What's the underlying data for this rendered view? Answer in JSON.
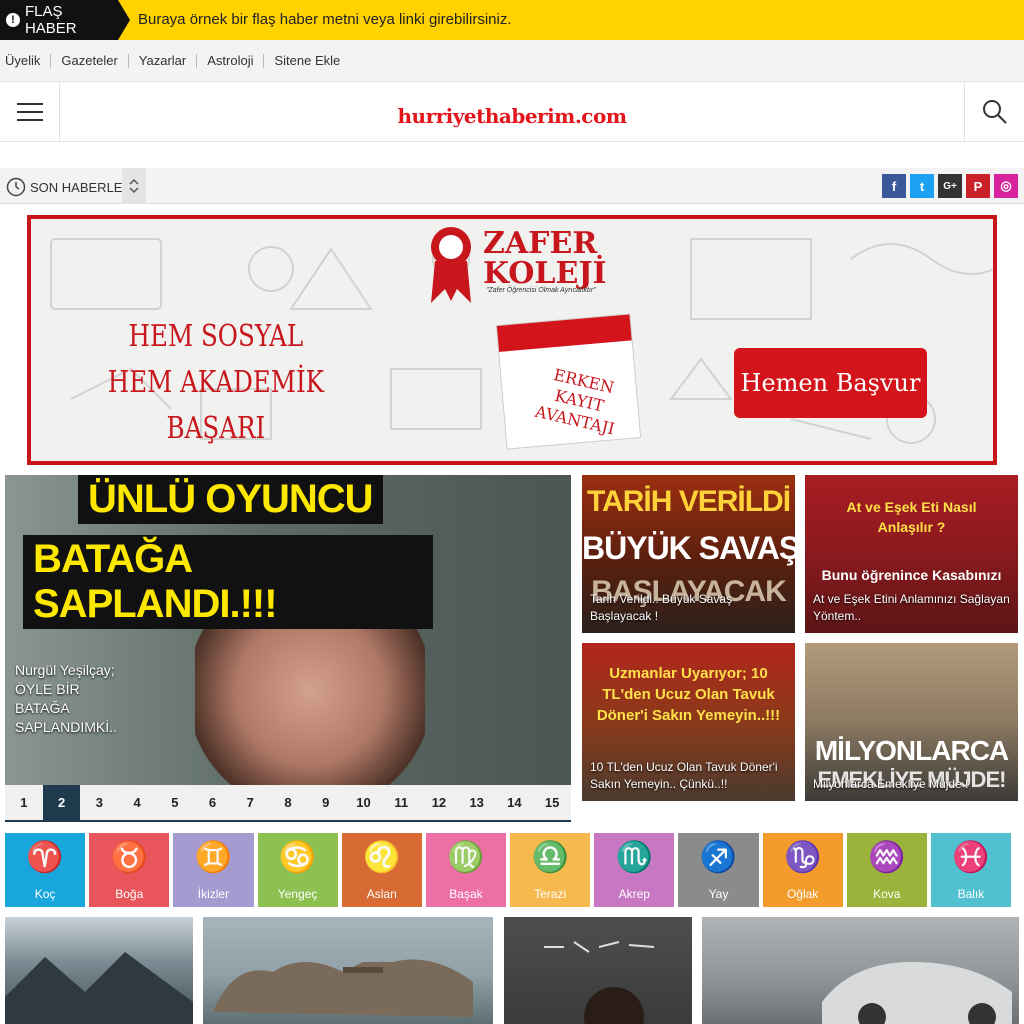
{
  "flash": {
    "tag": "FLAŞ HABER",
    "text": "Buraya örnek bir flaş haber metni veya linki girebilirsiniz."
  },
  "toplinks": [
    "Üyelik",
    "Gazeteler",
    "Yazarlar",
    "Astroloji",
    "Sitene Ekle"
  ],
  "header": {
    "logo": "hurriyethaberim.com"
  },
  "ticker": {
    "label": "SON HABERLER"
  },
  "social": [
    {
      "name": "facebook",
      "glyph": "f",
      "color": "#3b5998"
    },
    {
      "name": "twitter",
      "glyph": "t",
      "color": "#1da1f2"
    },
    {
      "name": "google-plus",
      "glyph": "G+",
      "color": "#333333"
    },
    {
      "name": "pinterest",
      "glyph": "P",
      "color": "#cb2027"
    },
    {
      "name": "instagram",
      "glyph": "◎",
      "color": "#d6249f"
    }
  ],
  "banner": {
    "school": "ZAFER KOLEJİ",
    "motto": "\"Zafer Öğrencisi Olmak Ayrıcalıktır\"",
    "slogan_line1": "HEM SOSYAL",
    "slogan_line2": "HEM AKADEMİK BAŞARI",
    "calendar_line1": "ERKEN KAYIT",
    "calendar_line2": "AVANTAJI",
    "button": "Hemen Başvur"
  },
  "slider": {
    "headline_line1": "ÜNLÜ OYUNCU",
    "headline_line2": "BATAĞA SAPLANDI.!!!",
    "caption": "Nurgül Yeşilçay; ÖYLE BİR BATAĞA SAPLANDIMKİ..",
    "pages": [
      "1",
      "2",
      "3",
      "4",
      "5",
      "6",
      "7",
      "8",
      "9",
      "10",
      "11",
      "12",
      "13",
      "14",
      "15"
    ],
    "active_page": "2"
  },
  "cards": [
    {
      "image_text_1": "TARİH VERİLDİ",
      "image_text_2": "BÜYÜK SAVAŞ",
      "image_text_3": "BAŞLAYACAK",
      "caption": "Tarih Verildi.. Büyük Savaş Başlayacak !"
    },
    {
      "image_text_1": "At ve Eşek Eti Nasıl Anlaşılır ?",
      "image_text_2": "Bunu öğrenince Kasabınızı",
      "caption": "At ve Eşek Etini Anlamınızı Sağlayan Yöntem.."
    },
    {
      "image_text_1": "Uzmanlar Uyarıyor; 10 TL'den Ucuz Olan Tavuk Döner'i Sakın Yemeyin..!!!",
      "caption": "10 TL'den Ucuz Olan Tavuk Döner'i Sakın Yemeyin.. Çünkü..!!"
    },
    {
      "image_text_1": "MİLYONLARCA",
      "image_text_2": "EMEKLİYE MÜJDE!",
      "caption": "Milyonlarca Emekliye Müjde !"
    }
  ],
  "zodiac": [
    {
      "label": "Koç",
      "glyph": "♈",
      "color": "#19a6dd"
    },
    {
      "label": "Boğa",
      "glyph": "♉",
      "color": "#e8555a"
    },
    {
      "label": "İkizler",
      "glyph": "♊",
      "color": "#a59bd1"
    },
    {
      "label": "Yengeç",
      "glyph": "♋",
      "color": "#8cc152"
    },
    {
      "label": "Aslan",
      "glyph": "♌",
      "color": "#d86a33"
    },
    {
      "label": "Başak",
      "glyph": "♍",
      "color": "#ec6fa6"
    },
    {
      "label": "Terazi",
      "glyph": "♎",
      "color": "#f5b94e"
    },
    {
      "label": "Akrep",
      "glyph": "♏",
      "color": "#c878c3"
    },
    {
      "label": "Yay",
      "glyph": "♐",
      "color": "#8b8b8b"
    },
    {
      "label": "Oğlak",
      "glyph": "♑",
      "color": "#f39c2b"
    },
    {
      "label": "Kova",
      "glyph": "♒",
      "color": "#9cb33b"
    },
    {
      "label": "Balık",
      "glyph": "♓",
      "color": "#52c1cf"
    }
  ]
}
